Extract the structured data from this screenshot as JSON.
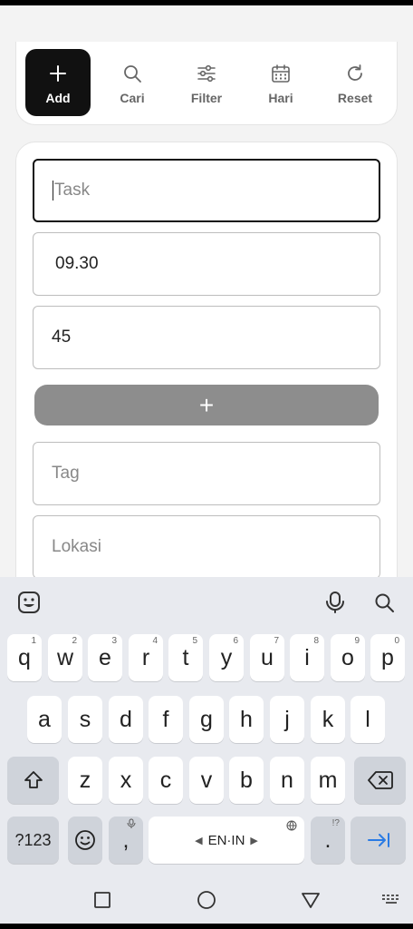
{
  "toolbar": {
    "items": [
      {
        "label": "Add",
        "icon": "plus-icon",
        "active": true
      },
      {
        "label": "Cari",
        "icon": "search-icon"
      },
      {
        "label": "Filter",
        "icon": "sliders-icon"
      },
      {
        "label": "Hari",
        "icon": "calendar-icon"
      },
      {
        "label": "Reset",
        "icon": "refresh-icon"
      }
    ]
  },
  "form": {
    "task_placeholder": "Task",
    "time_value": "09.30",
    "duration_value": "45",
    "add_label": "+",
    "tag_placeholder": "Tag",
    "location_placeholder": "Lokasi"
  },
  "keyboard": {
    "row1": [
      {
        "k": "q",
        "h": "1"
      },
      {
        "k": "w",
        "h": "2"
      },
      {
        "k": "e",
        "h": "3"
      },
      {
        "k": "r",
        "h": "4"
      },
      {
        "k": "t",
        "h": "5"
      },
      {
        "k": "y",
        "h": "6"
      },
      {
        "k": "u",
        "h": "7"
      },
      {
        "k": "i",
        "h": "8"
      },
      {
        "k": "o",
        "h": "9"
      },
      {
        "k": "p",
        "h": "0"
      }
    ],
    "row2": [
      "a",
      "s",
      "d",
      "f",
      "g",
      "h",
      "j",
      "k",
      "l"
    ],
    "row3": [
      "z",
      "x",
      "c",
      "v",
      "b",
      "n",
      "m"
    ],
    "sym_label": "?123",
    "comma": ",",
    "space_label": "EN·IN",
    "period": ".",
    "period_hint": "!?"
  },
  "colors": {
    "accent": "#111111",
    "add_button": "#8d8d8d",
    "keyboard_bg": "#e8eaef",
    "enter_key": "#2a7be4"
  }
}
